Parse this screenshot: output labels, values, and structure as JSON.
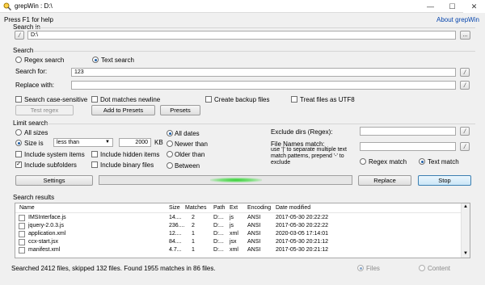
{
  "window": {
    "title": "grepWin : D:\\",
    "min": "—",
    "max": "☐",
    "close": "✕"
  },
  "help": {
    "text": "Press F1 for help",
    "about": "About grepWin"
  },
  "search_in": {
    "label": "Search in",
    "path": "D:\\",
    "browse": "..."
  },
  "search": {
    "label": "Search",
    "regex": "Regex search",
    "text": "Text search",
    "search_for_label": "Search for:",
    "search_for_value": "123",
    "replace_with_label": "Replace with:",
    "replace_with_value": "",
    "case_sensitive": "Search case-sensitive",
    "dot_newline": "Dot matches newline",
    "backup": "Create backup files",
    "utf8": "Treat files as UTF8",
    "test_regex": "Test regex",
    "add_presets": "Add to Presets",
    "presets": "Presets"
  },
  "limit": {
    "label": "Limit search",
    "all_sizes": "All sizes",
    "size_is": "Size is",
    "size_op": "less than",
    "size_value": "2000",
    "size_unit": "KB",
    "all_dates": "All dates",
    "newer": "Newer than",
    "older": "Older than",
    "between": "Between",
    "sys_items": "Include system items",
    "hidden_items": "Include hidden items",
    "subfolders": "Include subfolders",
    "binary": "Include binary files",
    "exclude_dirs": "Exclude dirs (Regex):",
    "fn_match_title": "File Names match:",
    "fn_match_help1": "use '|' to separate multiple text",
    "fn_match_help2": "match patterns, prepend '-' to",
    "fn_match_help3": "exclude",
    "regex_match": "Regex match",
    "text_match": "Text match"
  },
  "actions": {
    "settings": "Settings",
    "replace": "Replace",
    "stop": "Stop"
  },
  "results": {
    "label": "Search results",
    "columns": [
      "Name",
      "Size",
      "Matches",
      "Path",
      "Ext",
      "Encoding",
      "Date modified"
    ],
    "rows": [
      [
        "IMSInterface.js",
        "14....",
        "2",
        "D:...",
        "js",
        "ANSI",
        "2017-05-30 20:22:22"
      ],
      [
        "jquery-2.0.3.js",
        "236....",
        "2",
        "D:...",
        "js",
        "ANSI",
        "2017-05-30 20:22:22"
      ],
      [
        "application.xml",
        "12....",
        "1",
        "D:...",
        "xml",
        "ANSI",
        "2020-03-05 17:14:01"
      ],
      [
        "ccx-start.jsx",
        "84....",
        "1",
        "D:...",
        "jsx",
        "ANSI",
        "2017-05-30 20:21:12"
      ],
      [
        "manifest.xml",
        "4.7...",
        "1",
        "D:...",
        "xml",
        "ANSI",
        "2017-05-30 20:21:12"
      ]
    ]
  },
  "status": {
    "text": "Searched 2412 files, skipped 132 files. Found 1955 matches in 86 files.",
    "files": "Files",
    "content": "Content"
  },
  "colors": {
    "accent": "#3c7fb1",
    "progress": "#32cd32",
    "link": "#0645ad"
  }
}
